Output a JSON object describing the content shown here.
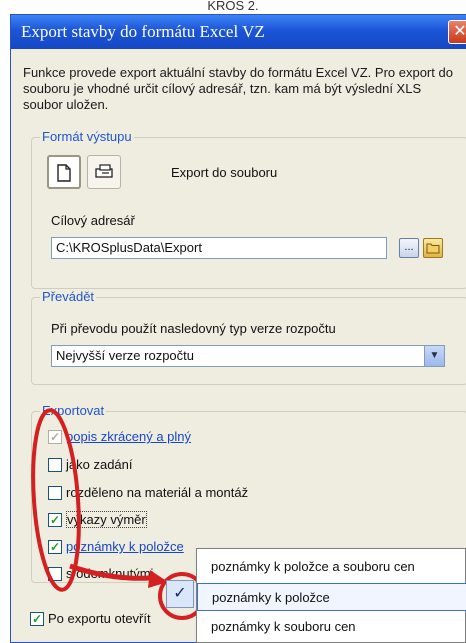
{
  "top_caption": "KROS 2.",
  "window": {
    "title": "Export stavby do formátu Excel VZ",
    "close_glyph": "✕",
    "description": "Funkce provede export aktuální stavby do formátu Excel VZ. Pro export do souboru je vhodné určit cílový adresář, tzn. kam má být výslední XLS soubor uložen."
  },
  "format_group": {
    "legend": "Formát výstupu",
    "file_icon": "document-icon",
    "print_icon": "printer-icon",
    "export_label": "Export do souboru",
    "target_label": "Cílový adresář",
    "target_value": "C:\\KROSplusData\\Export",
    "browse_label": "...",
    "folder_icon": "folder-icon"
  },
  "converter_group": {
    "legend": "Převádět",
    "prompt": "Při převodu použít nasledovný typ verze rozpočtu",
    "selected": "Nejvyšší verze rozpočtu",
    "arrow_glyph": "▼"
  },
  "export_group": {
    "legend": "Exportovat",
    "items": [
      {
        "label": "popis zkrácený a plný",
        "checked": true,
        "disabled": true
      },
      {
        "label": "jako zadání",
        "checked": false
      },
      {
        "label": "rozděleno na materiál a montáž",
        "checked": false
      },
      {
        "label": "výkazy výměr",
        "checked": true
      },
      {
        "label": "poznámky k položce",
        "checked": true
      },
      {
        "label": "s odemknutými",
        "checked": false
      }
    ]
  },
  "open_after": {
    "label": "Po exportu otevřít",
    "checked": true
  },
  "popup": {
    "items": [
      "poznámky k položce a souboru cen",
      "poznámky k položce",
      "poznámky k souboru cen"
    ],
    "check_glyph": "✓"
  },
  "check_glyph": "✓",
  "colors": {
    "title_blue": "#1c55d8",
    "annotation_red": "#d42020",
    "window_bg": "#efece0",
    "link_blue": "#1846c8"
  }
}
